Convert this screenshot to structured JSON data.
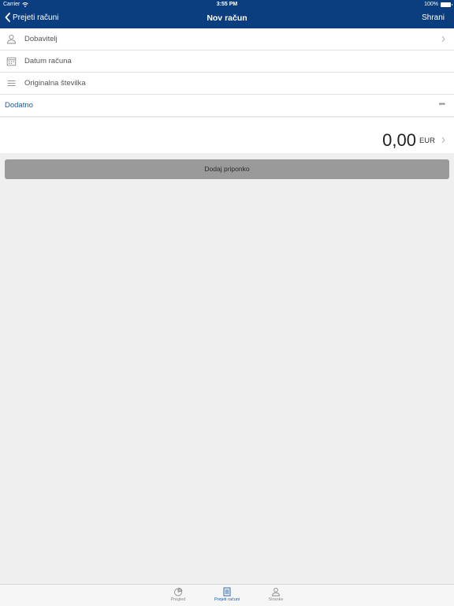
{
  "status_bar": {
    "carrier": "Carrier",
    "time": "3:55 PM",
    "battery": "100%"
  },
  "nav": {
    "back_label": "Prejeti računi",
    "title": "Nov račun",
    "save_label": "Shrani"
  },
  "form": {
    "rows": [
      {
        "label": "Dobavitelj",
        "icon": "person-icon",
        "chevron": true
      },
      {
        "label": "Datum računa",
        "icon": "calendar-icon",
        "chevron": false
      },
      {
        "label": "Originalna številka",
        "icon": "menu-lines-icon",
        "chevron": false
      }
    ],
    "extra_label": "Dodatno",
    "extra_icon": "more-dots-icon"
  },
  "amount": {
    "value": "0,00",
    "currency": "EUR"
  },
  "attach_button": "Dodaj priponko",
  "tab_bar": {
    "tabs": [
      {
        "label": "Pregled",
        "icon": "chart-pie-icon",
        "active": false
      },
      {
        "label": "Prejeti računi",
        "icon": "invoice-icon",
        "active": true
      },
      {
        "label": "Stranke",
        "icon": "person-icon",
        "active": false
      }
    ]
  },
  "colors": {
    "nav_background": "#0a3e7f",
    "accent": "#1a5aa8",
    "button_gray": "#9a9a9a"
  }
}
